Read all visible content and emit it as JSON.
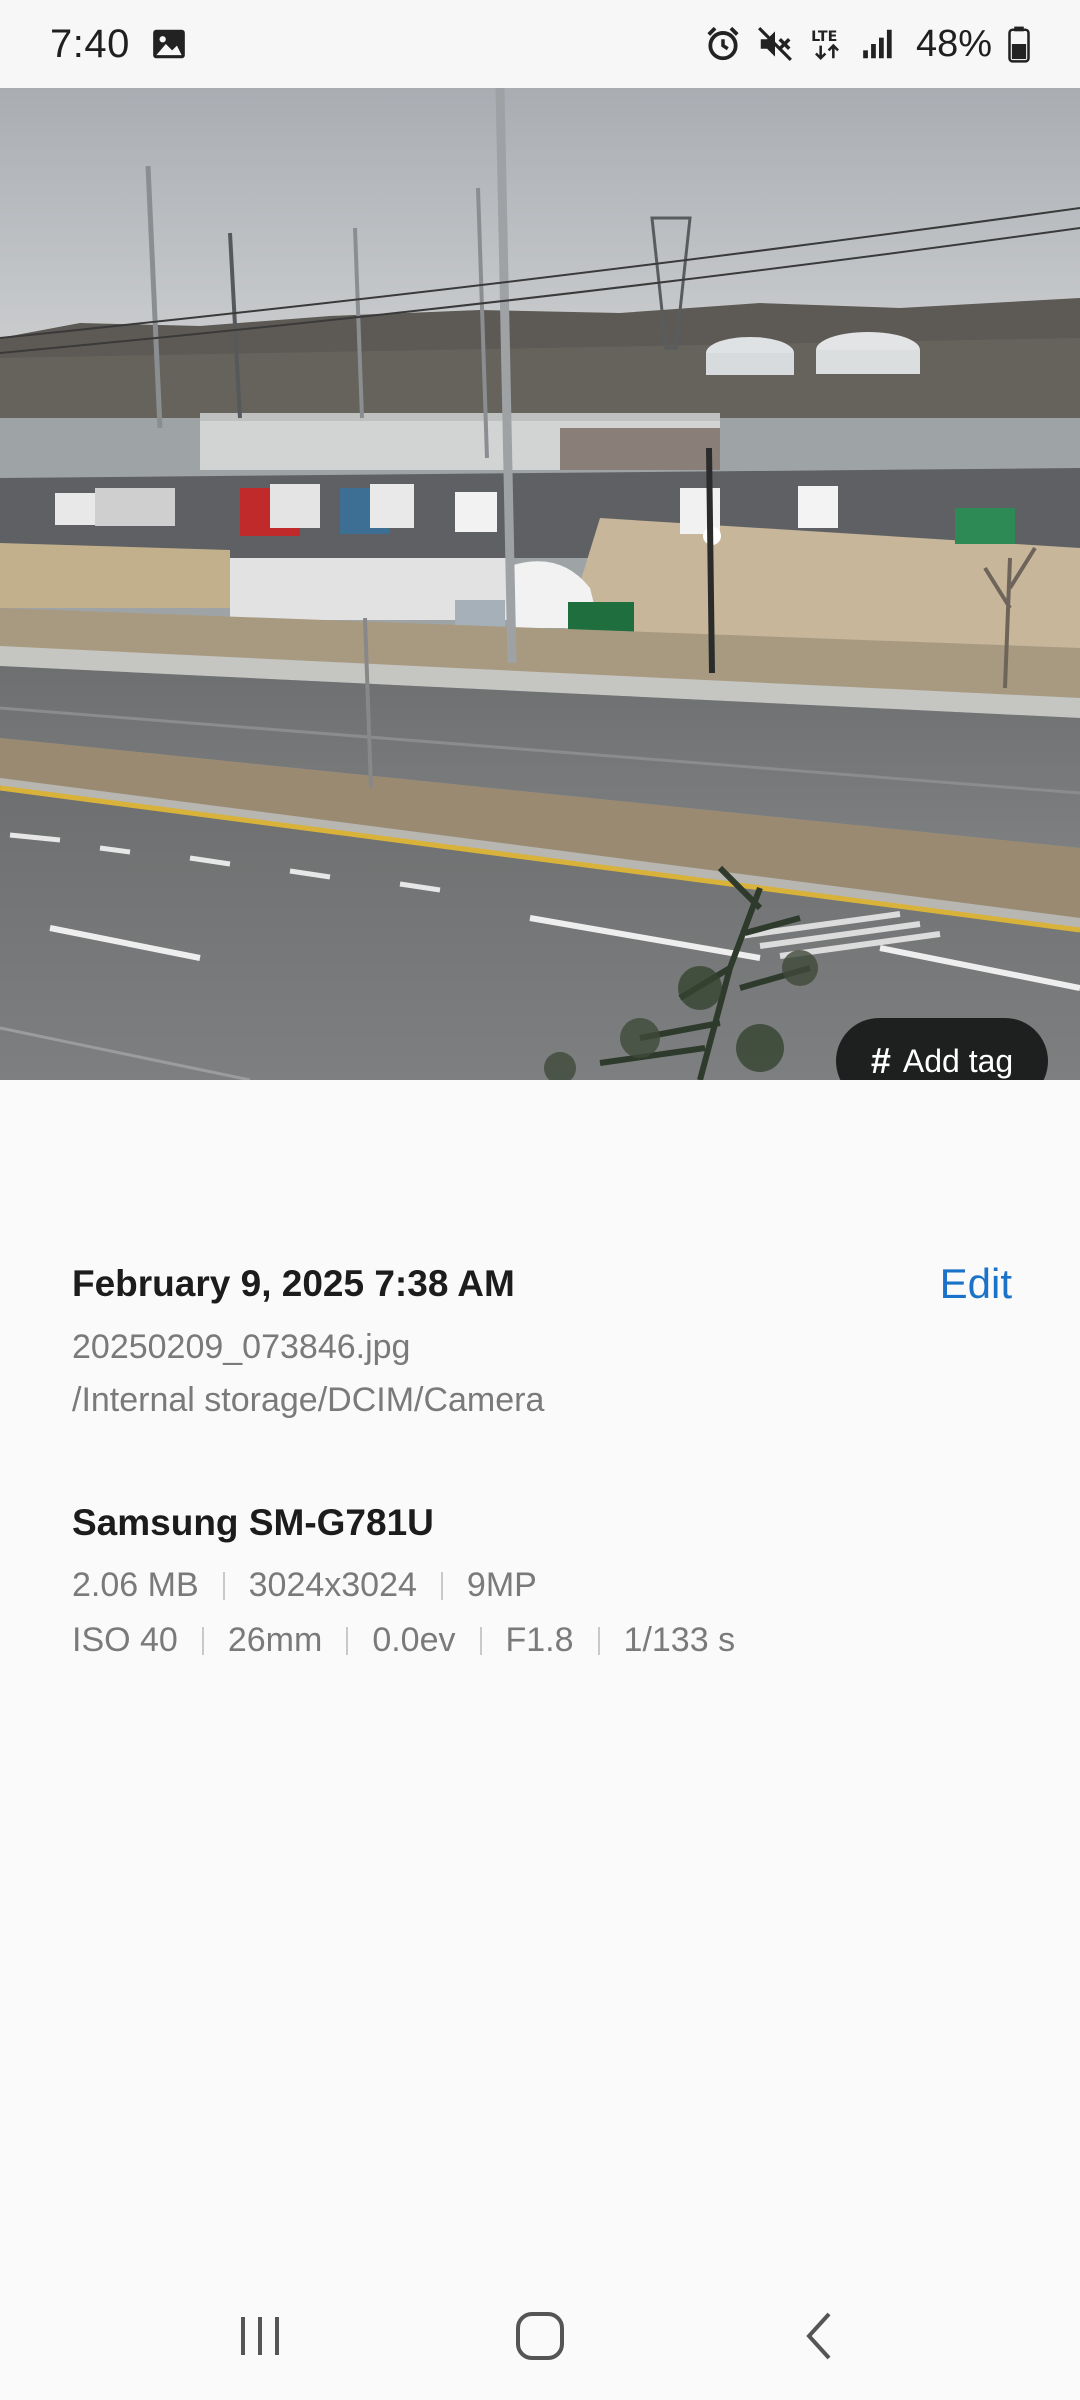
{
  "status_bar": {
    "time": "7:40",
    "battery": "48%",
    "icons": [
      "gallery-notification-icon",
      "alarm-icon",
      "mute-icon",
      "lte-icon",
      "signal-icon",
      "battery-icon"
    ]
  },
  "photo": {
    "add_tag_symbol": "#",
    "add_tag_label": "Add tag"
  },
  "details": {
    "date_time": "February 9, 2025 7:38 AM",
    "edit_label": "Edit",
    "file_name": "20250209_073846.jpg",
    "file_path": "/Internal storage/DCIM/Camera"
  },
  "device": {
    "model": "Samsung SM-G781U",
    "size": "2.06 MB",
    "resolution": "3024x3024",
    "megapixels": "9MP",
    "iso": "ISO 40",
    "focal_length": "26mm",
    "exposure_value": "0.0ev",
    "aperture": "F1.8",
    "shutter": "1/133 s"
  },
  "colors": {
    "accent": "#1a73c9",
    "tag_button_bg": "#1e1f1f",
    "background": "#fafafa"
  },
  "nav": {
    "icons": [
      "recent-apps-icon",
      "home-icon",
      "back-icon"
    ]
  }
}
